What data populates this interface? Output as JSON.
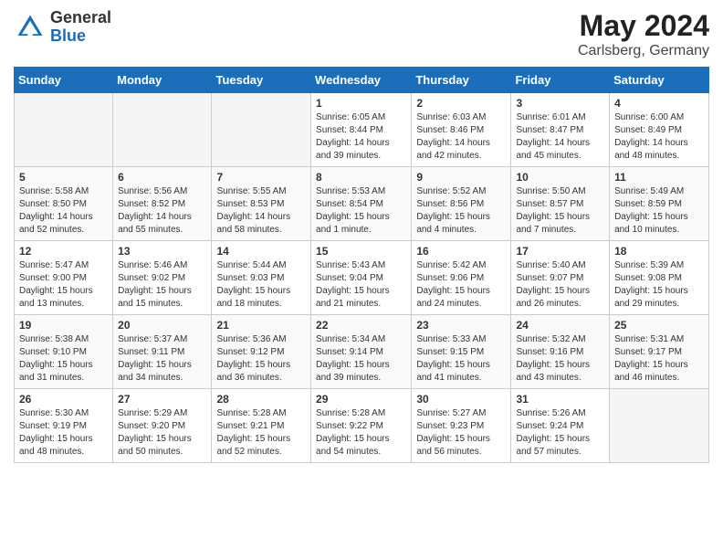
{
  "logo": {
    "general": "General",
    "blue": "Blue"
  },
  "title": {
    "month": "May 2024",
    "location": "Carlsberg, Germany"
  },
  "days_of_week": [
    "Sunday",
    "Monday",
    "Tuesday",
    "Wednesday",
    "Thursday",
    "Friday",
    "Saturday"
  ],
  "weeks": [
    [
      {
        "day": null,
        "info": null
      },
      {
        "day": null,
        "info": null
      },
      {
        "day": null,
        "info": null
      },
      {
        "day": "1",
        "sunrise": "6:05 AM",
        "sunset": "8:44 PM",
        "daylight": "14 hours and 39 minutes."
      },
      {
        "day": "2",
        "sunrise": "6:03 AM",
        "sunset": "8:46 PM",
        "daylight": "14 hours and 42 minutes."
      },
      {
        "day": "3",
        "sunrise": "6:01 AM",
        "sunset": "8:47 PM",
        "daylight": "14 hours and 45 minutes."
      },
      {
        "day": "4",
        "sunrise": "6:00 AM",
        "sunset": "8:49 PM",
        "daylight": "14 hours and 48 minutes."
      }
    ],
    [
      {
        "day": "5",
        "sunrise": "5:58 AM",
        "sunset": "8:50 PM",
        "daylight": "14 hours and 52 minutes."
      },
      {
        "day": "6",
        "sunrise": "5:56 AM",
        "sunset": "8:52 PM",
        "daylight": "14 hours and 55 minutes."
      },
      {
        "day": "7",
        "sunrise": "5:55 AM",
        "sunset": "8:53 PM",
        "daylight": "14 hours and 58 minutes."
      },
      {
        "day": "8",
        "sunrise": "5:53 AM",
        "sunset": "8:54 PM",
        "daylight": "15 hours and 1 minute."
      },
      {
        "day": "9",
        "sunrise": "5:52 AM",
        "sunset": "8:56 PM",
        "daylight": "15 hours and 4 minutes."
      },
      {
        "day": "10",
        "sunrise": "5:50 AM",
        "sunset": "8:57 PM",
        "daylight": "15 hours and 7 minutes."
      },
      {
        "day": "11",
        "sunrise": "5:49 AM",
        "sunset": "8:59 PM",
        "daylight": "15 hours and 10 minutes."
      }
    ],
    [
      {
        "day": "12",
        "sunrise": "5:47 AM",
        "sunset": "9:00 PM",
        "daylight": "15 hours and 13 minutes."
      },
      {
        "day": "13",
        "sunrise": "5:46 AM",
        "sunset": "9:02 PM",
        "daylight": "15 hours and 15 minutes."
      },
      {
        "day": "14",
        "sunrise": "5:44 AM",
        "sunset": "9:03 PM",
        "daylight": "15 hours and 18 minutes."
      },
      {
        "day": "15",
        "sunrise": "5:43 AM",
        "sunset": "9:04 PM",
        "daylight": "15 hours and 21 minutes."
      },
      {
        "day": "16",
        "sunrise": "5:42 AM",
        "sunset": "9:06 PM",
        "daylight": "15 hours and 24 minutes."
      },
      {
        "day": "17",
        "sunrise": "5:40 AM",
        "sunset": "9:07 PM",
        "daylight": "15 hours and 26 minutes."
      },
      {
        "day": "18",
        "sunrise": "5:39 AM",
        "sunset": "9:08 PM",
        "daylight": "15 hours and 29 minutes."
      }
    ],
    [
      {
        "day": "19",
        "sunrise": "5:38 AM",
        "sunset": "9:10 PM",
        "daylight": "15 hours and 31 minutes."
      },
      {
        "day": "20",
        "sunrise": "5:37 AM",
        "sunset": "9:11 PM",
        "daylight": "15 hours and 34 minutes."
      },
      {
        "day": "21",
        "sunrise": "5:36 AM",
        "sunset": "9:12 PM",
        "daylight": "15 hours and 36 minutes."
      },
      {
        "day": "22",
        "sunrise": "5:34 AM",
        "sunset": "9:14 PM",
        "daylight": "15 hours and 39 minutes."
      },
      {
        "day": "23",
        "sunrise": "5:33 AM",
        "sunset": "9:15 PM",
        "daylight": "15 hours and 41 minutes."
      },
      {
        "day": "24",
        "sunrise": "5:32 AM",
        "sunset": "9:16 PM",
        "daylight": "15 hours and 43 minutes."
      },
      {
        "day": "25",
        "sunrise": "5:31 AM",
        "sunset": "9:17 PM",
        "daylight": "15 hours and 46 minutes."
      }
    ],
    [
      {
        "day": "26",
        "sunrise": "5:30 AM",
        "sunset": "9:19 PM",
        "daylight": "15 hours and 48 minutes."
      },
      {
        "day": "27",
        "sunrise": "5:29 AM",
        "sunset": "9:20 PM",
        "daylight": "15 hours and 50 minutes."
      },
      {
        "day": "28",
        "sunrise": "5:28 AM",
        "sunset": "9:21 PM",
        "daylight": "15 hours and 52 minutes."
      },
      {
        "day": "29",
        "sunrise": "5:28 AM",
        "sunset": "9:22 PM",
        "daylight": "15 hours and 54 minutes."
      },
      {
        "day": "30",
        "sunrise": "5:27 AM",
        "sunset": "9:23 PM",
        "daylight": "15 hours and 56 minutes."
      },
      {
        "day": "31",
        "sunrise": "5:26 AM",
        "sunset": "9:24 PM",
        "daylight": "15 hours and 57 minutes."
      },
      {
        "day": null,
        "info": null
      }
    ]
  ]
}
